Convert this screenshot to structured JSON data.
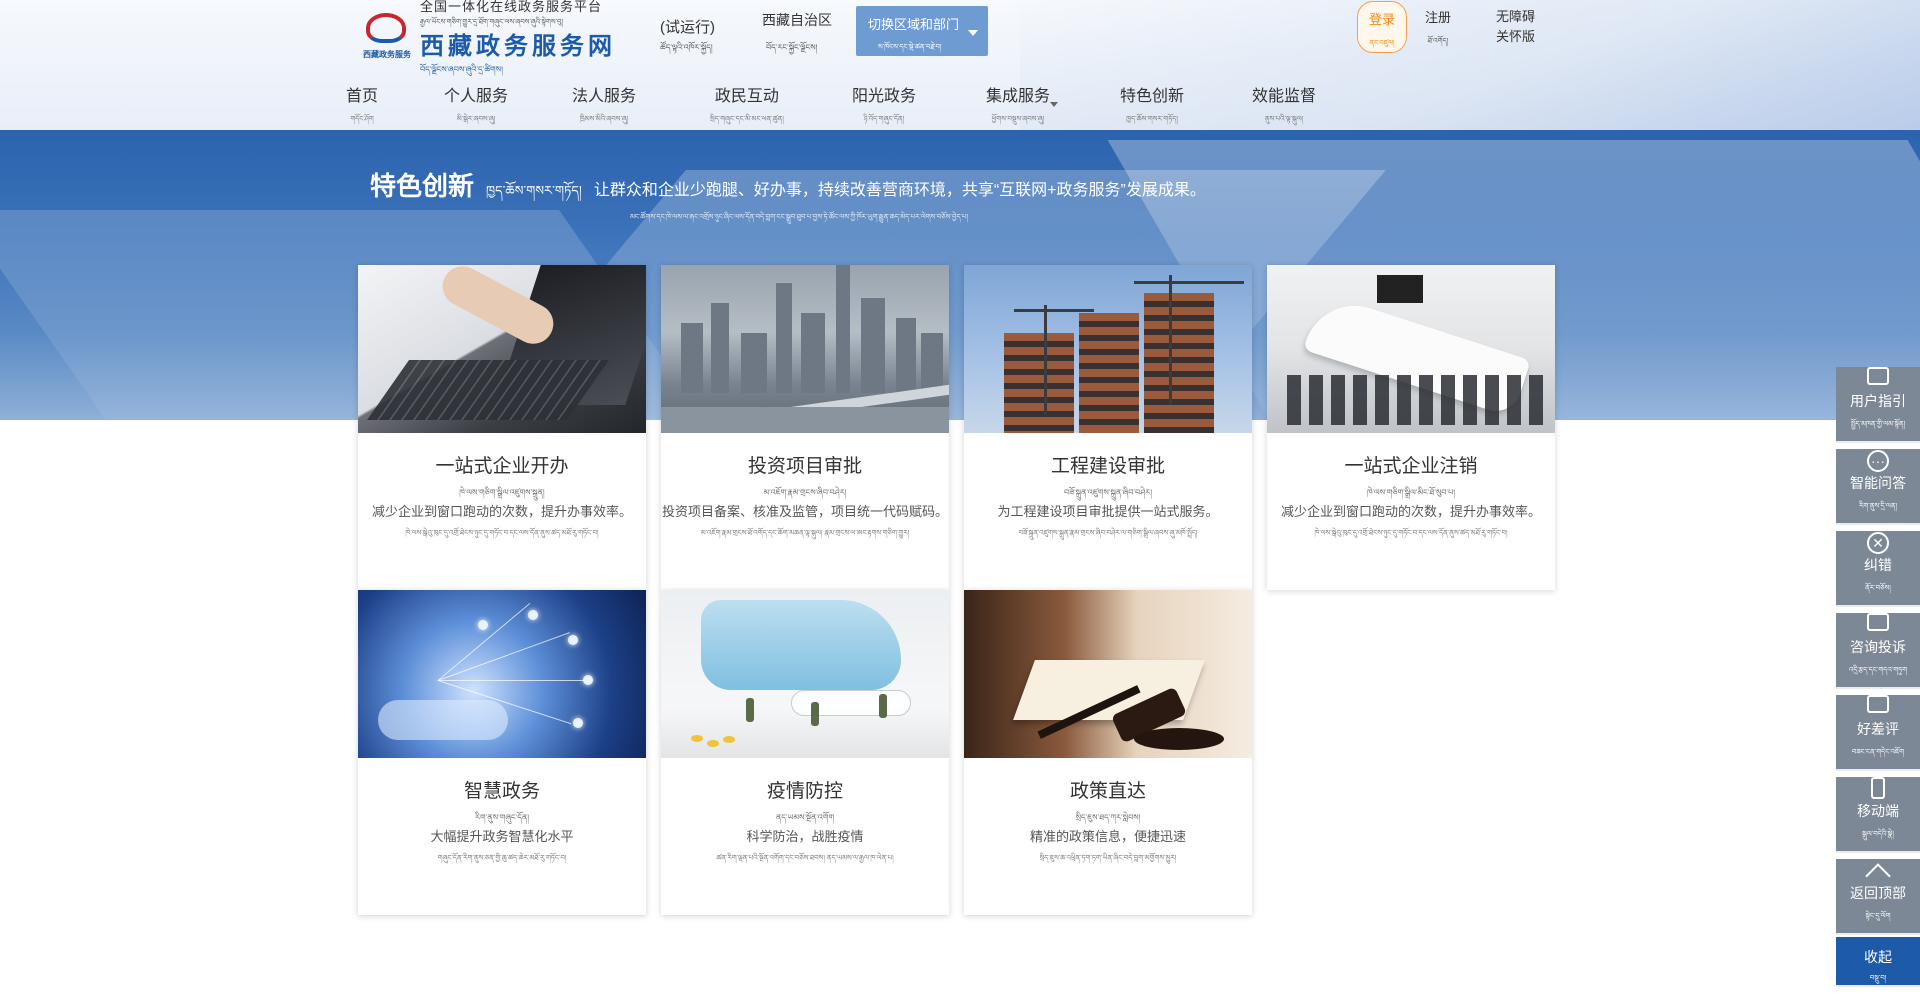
{
  "header": {
    "logo": {
      "line1": "全国一体化在线政务服务平台",
      "line2": "རྒྱལ་ཡོངས་གཅིག་གྱུར་དྲ་ཐོག་གཞུང་ལས་ཞབས་ཞུའི་སྟེགས་བུ།",
      "title": "西藏政务服务网",
      "title_bo": "བོད་ལྗོངས་ཞབས་ཞུའི་དྲ་ཚིགས།",
      "emblem_caption": "西藏政务服务"
    },
    "trial": "(试运行)",
    "trial_bo": "ཚོད་ལྟའི་འཁོར་སྐྱོད།",
    "region": "西藏自治区",
    "region_bo": "བོད་རང་སྐྱོང་ལྗོངས།",
    "switch": {
      "label": "切换区域和部门",
      "label_bo": "ས་ཁོངས་དང་སྡེ་ཚན་བརྗེ་བ།"
    },
    "login": {
      "label": "登录",
      "label_bo": "ནང་འཛུལ།"
    },
    "register": {
      "label": "注册",
      "label_bo": "ཐོ་འགོད།"
    },
    "accessibility": {
      "line1": "无障碍",
      "line2": "关怀版"
    },
    "nav": [
      {
        "label": "首页",
        "label_bo": "གདོང་ཤོག"
      },
      {
        "label": "个人服务",
        "label_bo": "མི་སྒེར་ཞབས་ཞུ།"
      },
      {
        "label": "法人服务",
        "label_bo": "ཁྲིམས་མིའི་ཞབས་ཞུ།"
      },
      {
        "label": "政民互动",
        "label_bo": "སྲིད་གཞུང་དང་མི་མང་ཕན་ཚུན།"
      },
      {
        "label": "阳光政务",
        "label_bo": "ཉི་འོད་གཞུང་དོན།"
      },
      {
        "label": "集成服务",
        "label_bo": "ཕྱོགས་བསྡུས་ཞབས་ཞུ།"
      },
      {
        "label": "特色创新",
        "label_bo": "ཁྱད་ཆོས་གསར་གཏོད།"
      },
      {
        "label": "效能监督",
        "label_bo": "ནུས་པའི་ལྟ་སྐུལ།"
      }
    ]
  },
  "banner": {
    "title": "特色创新",
    "title_bo": "ཁྱད་ཆོས་གསར་གཏོད།",
    "desc": "让群众和企业少跑腿、好办事，持续改善营商环境，共享“互联网+政务服务”发展成果。",
    "desc_bo": "མང་ཚོགས་དང་ཁེ་ལས་ལ་རྐང་འགྲོས་ཉུང་ཞིང་ལས་དོན་བདེ་བླག་ངང་སྒྲུབ་ཐུབ་པ་བྱས་ཏེ་ཚོང་ལས་ཀྱི་ཁོར་ཡུག་རྒྱུན་ཆད་མེད་པར་ལེགས་བཅོས་བྱེད་པ།"
  },
  "cards": [
    {
      "title": "一站式企业开办",
      "title_bo": "ཁེ་ལས་གཅིག་སྒྲིལ་འཛུགས་སྐྲུན།",
      "desc": "减少企业到窗口跑动的次数，提升办事效率。",
      "desc_bo": "ཁེ་ལས་སྒེའུ་ཁུང་དུ་འགྲོ་ཐེངས་ཉུང་དུ་གཏོང་བ་དང་ལས་དོན་ནུས་ཚད་མཐོ་རུ་གཏོང་བ།"
    },
    {
      "title": "投资项目审批",
      "title_bo": "མ་འཇོག་རྣམ་གྲངས་ཞིབ་བཤེར།",
      "desc": "投资项目备案、核准及监管，项目统一代码赋码。",
      "desc_bo": "མ་འཇོག་རྣམ་གྲངས་ཐོ་འགོད་དང་ཆོག་མཆན་ལྟ་སྐུལ། རྣམ་གྲངས་ལ་ཨང་རྟགས་གཅིག་གྱུར།"
    },
    {
      "title": "工程建设审批",
      "title_bo": "བཟོ་སྐྲུན་འཛུགས་སྐྲུན་ཞིབ་བཤེར།",
      "desc": "为工程建设项目审批提供一站式服务。",
      "desc_bo": "བཟོ་སྐྲུན་འཛུགས་སྐྲུན་རྣམ་གྲངས་ཞིབ་བཤེར་ལ་གཅིག་སྒྲིལ་ཞབས་ཞུ་མཁོ་སྤྲོད།"
    },
    {
      "title": "一站式企业注销",
      "title_bo": "ཁེ་ལས་གཅིག་སྒྲིལ་མིང་ཐོ་སུབ་པ།",
      "desc": "减少企业到窗口跑动的次数，提升办事效率。",
      "desc_bo": "ཁེ་ལས་སྒེའུ་ཁུང་དུ་འགྲོ་ཐེངས་ཉུང་དུ་གཏོང་བ་དང་ལས་དོན་ནུས་ཚད་མཐོ་རུ་གཏོང་བ།"
    },
    {
      "title": "智慧政务",
      "title_bo": "རིག་ནུས་གཞུང་དོན།",
      "desc": "大幅提升政务智慧化水平",
      "desc_bo": "གཞུང་དོན་རིག་ནུས་ཅན་གྱི་ཆུ་ཚད་ཆེར་མཐོ་རུ་གཏོང་བ།"
    },
    {
      "title": "疫情防控",
      "title_bo": "ནད་ཡམས་སྔོན་འགོག",
      "desc": "科学防治，战胜疫情",
      "desc_bo": "ཚན་རིག་ལྡན་པའི་སྔོན་འགོག་དང་བཅོས་ཐབས། ནད་ཡམས་ལ་རྒྱལ་ཁ་ལེན་པ།"
    },
    {
      "title": "政策直达",
      "title_bo": "སྲིད་ཇུས་ཐད་ཀར་སླེབས།",
      "desc": "精准的政策信息，便捷迅速",
      "desc_bo": "སྲིད་ཇུས་ཆ་འཕྲིན་ཏག་ཏག་ཡིན་ཞིང་བདེ་བླག་མགྱོགས་མྱུར།"
    }
  ],
  "sidebar": [
    {
      "label": "用户指引",
      "label_bo": "སྤྱོད་མཁན་གྱི་ལམ་སྟོན།",
      "icon": "guide-icon"
    },
    {
      "label": "智能问答",
      "label_bo": "རིག་ནུས་དྲི་ལན།",
      "icon": "chat-icon"
    },
    {
      "label": "纠错",
      "label_bo": "ནོར་བཅོས།",
      "icon": "error-icon"
    },
    {
      "label": "咨询投诉",
      "label_bo": "འདྲི་རྩད་དང་གདའ་གཏུག",
      "icon": "complaint-icon"
    },
    {
      "label": "好差评",
      "label_bo": "བཟང་ངན་གདེང་འཇོག",
      "icon": "rating-icon"
    },
    {
      "label": "移动端",
      "label_bo": "སྒུལ་བདེའི་སྣེ།",
      "icon": "mobile-icon"
    },
    {
      "label": "返回顶部",
      "label_bo": "སྟེང་དུ་ལོག",
      "icon": "back-top-icon"
    },
    {
      "label": "收起",
      "label_bo": "བསྡུ་བ།",
      "icon": "collapse-icon"
    }
  ],
  "colors": {
    "brand_blue": "#1d5ba8",
    "login_orange": "#f08a18",
    "sidebar_gray": "#7d8896"
  }
}
